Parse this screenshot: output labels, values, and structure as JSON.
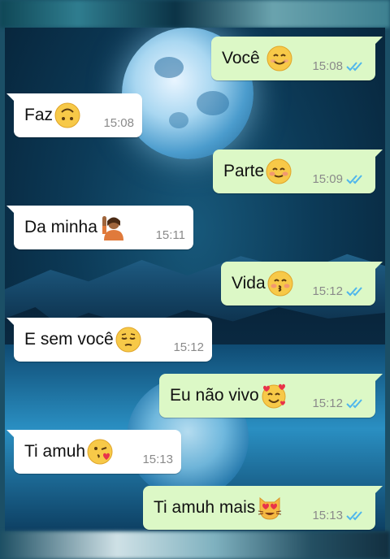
{
  "colors": {
    "outgoing_bubble": "#dcf8c6",
    "incoming_bubble": "#ffffff",
    "timestamp": "#8a8a8a",
    "read_check": "#4fb6ec"
  },
  "messages": [
    {
      "direction": "out",
      "text": "Você",
      "emoji": "smiling-face-icon",
      "time": "15:08",
      "read": true
    },
    {
      "direction": "in",
      "text": "Faz",
      "emoji": "upside-down-face-icon",
      "time": "15:08"
    },
    {
      "direction": "out",
      "text": "Parte",
      "emoji": "smiling-blush-face-icon",
      "time": "15:09",
      "read": true
    },
    {
      "direction": "in",
      "text": "Da minha",
      "emoji": "person-raising-hand-icon",
      "time": "15:11"
    },
    {
      "direction": "out",
      "text": "Vida",
      "emoji": "kissing-closed-eyes-face-icon",
      "time": "15:12",
      "read": true
    },
    {
      "direction": "in",
      "text": "E sem você",
      "emoji": "pensive-face-icon",
      "time": "15:12"
    },
    {
      "direction": "out",
      "text": "Eu não vivo",
      "emoji": "smiling-face-with-hearts-icon",
      "time": "15:12",
      "read": true
    },
    {
      "direction": "in",
      "text": "Ti amuh",
      "emoji": "face-blowing-kiss-icon",
      "time": "15:13"
    },
    {
      "direction": "out",
      "text": "Ti amuh mais",
      "emoji": "heart-eyes-cat-icon",
      "time": "15:13",
      "read": true
    }
  ]
}
